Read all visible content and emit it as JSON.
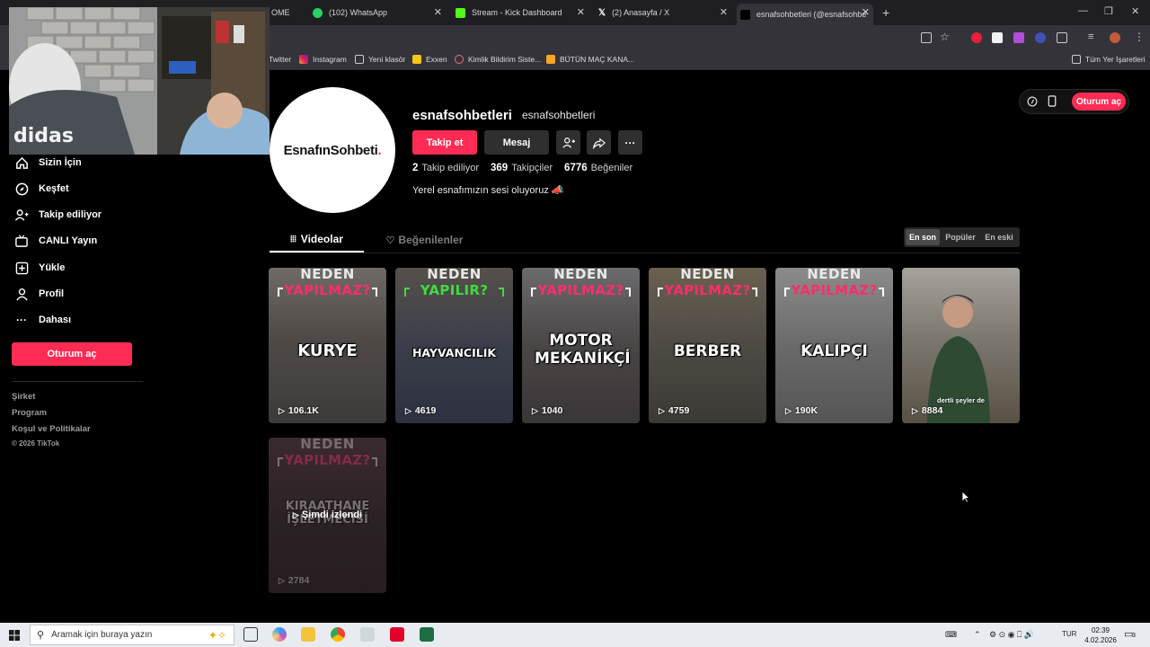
{
  "browser": {
    "tabs": [
      {
        "label": "OME"
      },
      {
        "label": "(102) WhatsApp"
      },
      {
        "label": "Stream - Kick Dashboard"
      },
      {
        "label": "(2) Anasayfa / X"
      },
      {
        "label": "esnafsohbetleri (@esnafsohbe"
      }
    ],
    "bookmarks": [
      {
        "label": "Twitter"
      },
      {
        "label": "Instagram"
      },
      {
        "label": "Yeni klasör"
      },
      {
        "label": "Exxen"
      },
      {
        "label": "Kimlik Bildirim Siste..."
      },
      {
        "label": "BÜTÜN MAÇ KANA..."
      },
      {
        "label": "Tüm Yer İşaretleri"
      }
    ]
  },
  "sidebar": {
    "items": [
      {
        "label": "Sizin İçin"
      },
      {
        "label": "Keşfet"
      },
      {
        "label": "Takip ediliyor"
      },
      {
        "label": "CANLI Yayın"
      },
      {
        "label": "Yükle"
      },
      {
        "label": "Profil"
      },
      {
        "label": "Dahası"
      }
    ],
    "login_label": "Oturum aç",
    "footer": [
      "Şirket",
      "Program",
      "Koşul ve Politikalar",
      "© 2026 TikTok"
    ]
  },
  "profile": {
    "avatar_text": "EsnafınSohbeti",
    "avatar_dot": ".",
    "username": "esnafsohbetleri",
    "nickname": "esnafsohbetleri",
    "follow_label": "Takip et",
    "message_label": "Mesaj",
    "stats": {
      "following": "2",
      "following_label": "Takip ediliyor",
      "followers": "369",
      "followers_label": "Takipçiler",
      "likes": "6776",
      "likes_label": "Beğeniler"
    },
    "bio": "Yerel esnafımızın sesi oluyoruz 📣"
  },
  "topright": {
    "login_label": "Oturum aç"
  },
  "content_tabs": {
    "videos": "Videolar",
    "liked": "Beğenilenler",
    "sort": [
      "En son",
      "Popüler",
      "En eski"
    ]
  },
  "videos": [
    {
      "top": "NEDEN",
      "mid": "YAPILMAZ?",
      "title": "KURYE",
      "views": "106.1K"
    },
    {
      "top": "NEDEN",
      "mid": "YAPILIR?",
      "title": "HAYVANCILIK",
      "views": "4619"
    },
    {
      "top": "NEDEN",
      "mid": "YAPILMAZ?",
      "title": "MOTOR MEKANİKÇİ",
      "views": "1040"
    },
    {
      "top": "NEDEN",
      "mid": "YAPILMAZ?",
      "title": "BERBER",
      "views": "4759"
    },
    {
      "top": "NEDEN",
      "mid": "YAPILMAZ?",
      "title": "KALIPÇI",
      "views": "190K"
    },
    {
      "caption": "dertli şeyler de",
      "caption_hl": "bir şeyler de",
      "views": "8884"
    },
    {
      "top": "NEDEN",
      "mid": "YAPILMAZ?",
      "title": "KIRAATHANE İŞLETMECİSİ",
      "views": "2784",
      "overlay": "Şimdi izlendi"
    }
  ],
  "taskbar": {
    "search_placeholder": "Aramak için buraya yazın",
    "lang": "TUR",
    "time": "02:39",
    "date": "4.02.2026",
    "notif_count": "3"
  }
}
